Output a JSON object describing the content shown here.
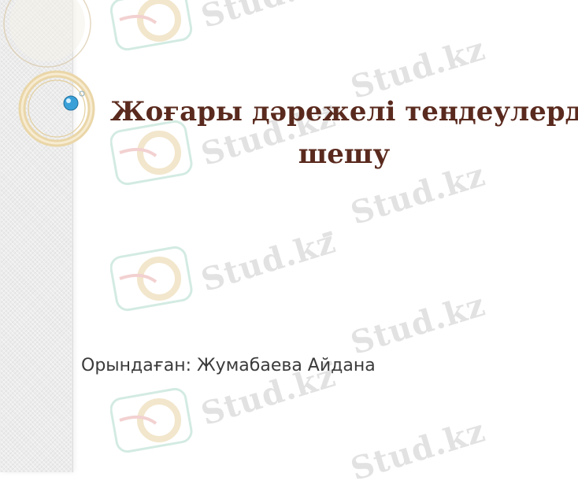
{
  "slide": {
    "title_line1": "Жоғары дәрежелі теңдеулерді",
    "title_line2": "шешу",
    "author": "Орындаған: Жумабаева Айдана"
  },
  "watermark": {
    "text": "Stud.kz"
  },
  "colors": {
    "title": "#5a2a1e",
    "author": "#3b3b3b",
    "ring_gold": "#e6cfa0",
    "bead_blue": "#3aa0d8"
  }
}
